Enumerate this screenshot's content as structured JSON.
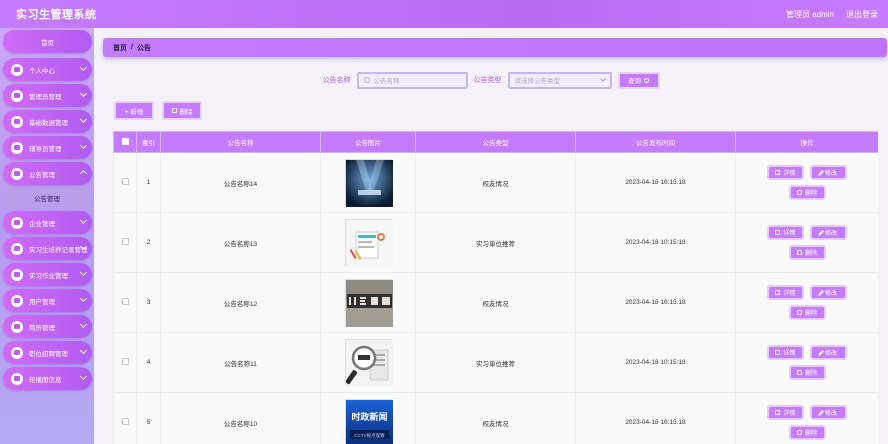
{
  "app": {
    "title": "实习生管理系统",
    "user": "管理员 admin",
    "logout": "退出登录"
  },
  "sidebar": {
    "home": "首页",
    "items": [
      {
        "label": "个人中心"
      },
      {
        "label": "管理员管理"
      },
      {
        "label": "基础数据管理"
      },
      {
        "label": "辅导员管理"
      },
      {
        "label": "公告管理",
        "sub": "公告管理"
      },
      {
        "label": "企业管理"
      },
      {
        "label": "实习生培养记录管理"
      },
      {
        "label": "实习作业管理"
      },
      {
        "label": "用户管理"
      },
      {
        "label": "简历管理"
      },
      {
        "label": "职位招聘管理"
      },
      {
        "label": "轮播图信息"
      }
    ]
  },
  "breadcrumb": {
    "home": "首页",
    "sep": "/",
    "current": "公告"
  },
  "search": {
    "name_label": "公告名称",
    "name_placeholder": "公告名称",
    "type_label": "公告类型",
    "type_placeholder": "请选择公告类型",
    "query_button": "查询"
  },
  "actions": {
    "add": "+ 新增",
    "delete": "删除"
  },
  "table": {
    "headers": [
      "索引",
      "公告名称",
      "公告图片",
      "公告类型",
      "公告发布时间",
      "操作"
    ],
    "rows": [
      {
        "index": "1",
        "name": "公告名称14",
        "type": "校友情况",
        "time": "2023-04-18 10:15:18",
        "image": "stage-lights"
      },
      {
        "index": "2",
        "name": "公告名称13",
        "type": "实习单位推荐",
        "time": "2023-04-18 10:15:18",
        "image": "report-clipboard"
      },
      {
        "index": "3",
        "name": "公告名称12",
        "type": "校友情况",
        "time": "2023-04-18 10:15:18",
        "image": "news-blocks"
      },
      {
        "index": "4",
        "name": "公告名称11",
        "type": "实习单位推荐",
        "time": "2023-04-18 10:15:18",
        "image": "magnifier-news"
      },
      {
        "index": "5",
        "name": "公告名称10",
        "type": "校友情况",
        "time": "2023-04-18 10:15:18",
        "image": "current-affairs-news"
      }
    ],
    "ops": {
      "detail": "详情",
      "edit": "修改",
      "delete": "删除"
    }
  },
  "thumb_text": {
    "row5_line1": "时政新闻",
    "row5_line2": "CCTV视点观察"
  },
  "colors": {
    "accent": "#c57bff",
    "sidebar_top": "#c9a8f4",
    "sidebar_bottom": "#b3a9f3"
  }
}
